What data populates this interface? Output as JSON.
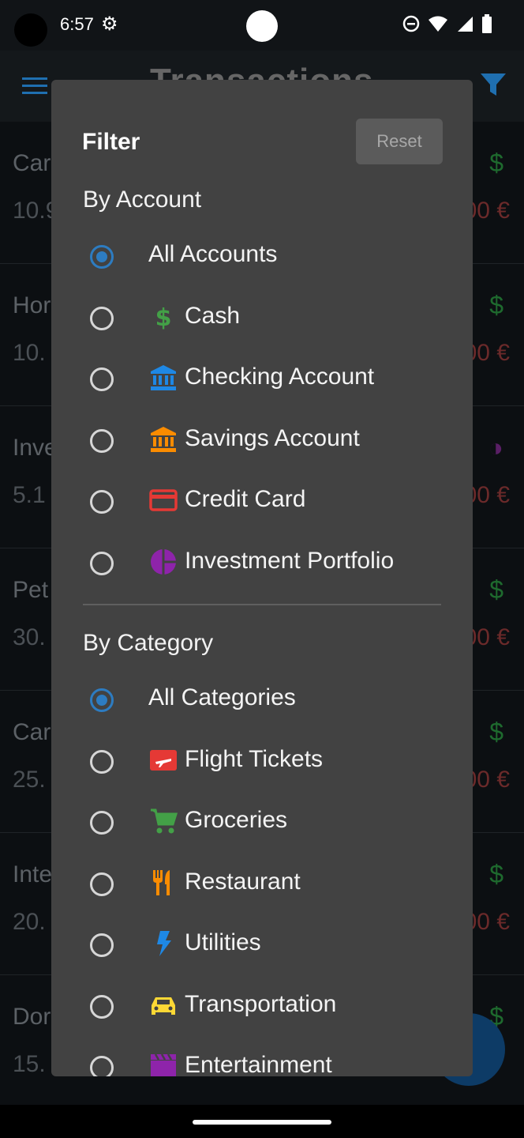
{
  "status_bar": {
    "time": "6:57"
  },
  "app": {
    "title": "Transactions",
    "rows": [
      {
        "name": "Car",
        "date": "10.9",
        "amount": "00 €",
        "icon_color": "#1e6a2e",
        "icon": "$"
      },
      {
        "name": "Hor",
        "date": "10.",
        "amount": "00 €",
        "icon_color": "#1e6a2e",
        "icon": "$"
      },
      {
        "name": "Inve",
        "date": "5.1",
        "amount": "00 €",
        "icon_color": "#5a1f66",
        "icon": "◑"
      },
      {
        "name": "Pet",
        "date": "30.",
        "amount": "00 €",
        "icon_color": "#1e6a2e",
        "icon": "$"
      },
      {
        "name": "Car",
        "date": "25.",
        "amount": "00 €",
        "icon_color": "#1e6a2e",
        "icon": "$"
      },
      {
        "name": "Inte",
        "date": "20.",
        "amount": "00 €",
        "icon_color": "#1e6a2e",
        "icon": "$"
      },
      {
        "name": "Dor",
        "date": "15.",
        "amount": "",
        "icon_color": "#1e6a2e",
        "icon": "$"
      }
    ]
  },
  "dialog": {
    "title": "Filter",
    "reset_label": "Reset",
    "by_account": {
      "heading": "By Account",
      "options": [
        {
          "label": "All Accounts",
          "selected": true,
          "icon": null
        },
        {
          "label": "Cash",
          "selected": false,
          "icon": "cash-icon",
          "color": "#43a047"
        },
        {
          "label": "Checking Account",
          "selected": false,
          "icon": "bank-icon",
          "color": "#1e88e5"
        },
        {
          "label": "Savings Account",
          "selected": false,
          "icon": "bank-icon",
          "color": "#fb8c00"
        },
        {
          "label": "Credit Card",
          "selected": false,
          "icon": "credit-card-icon",
          "color": "#e53935"
        },
        {
          "label": "Investment Portfolio",
          "selected": false,
          "icon": "pie-chart-icon",
          "color": "#8e24aa"
        }
      ]
    },
    "by_category": {
      "heading": "By Category",
      "options": [
        {
          "label": "All Categories",
          "selected": true,
          "icon": null
        },
        {
          "label": "Flight Tickets",
          "selected": false,
          "icon": "flight-icon",
          "color": "#e53935"
        },
        {
          "label": "Groceries",
          "selected": false,
          "icon": "cart-icon",
          "color": "#43a047"
        },
        {
          "label": "Restaurant",
          "selected": false,
          "icon": "restaurant-icon",
          "color": "#fb8c00"
        },
        {
          "label": "Utilities",
          "selected": false,
          "icon": "bolt-icon",
          "color": "#1e88e5"
        },
        {
          "label": "Transportation",
          "selected": false,
          "icon": "car-icon",
          "color": "#fdd835"
        },
        {
          "label": "Entertainment",
          "selected": false,
          "icon": "movie-icon",
          "color": "#8e24aa"
        }
      ]
    }
  }
}
